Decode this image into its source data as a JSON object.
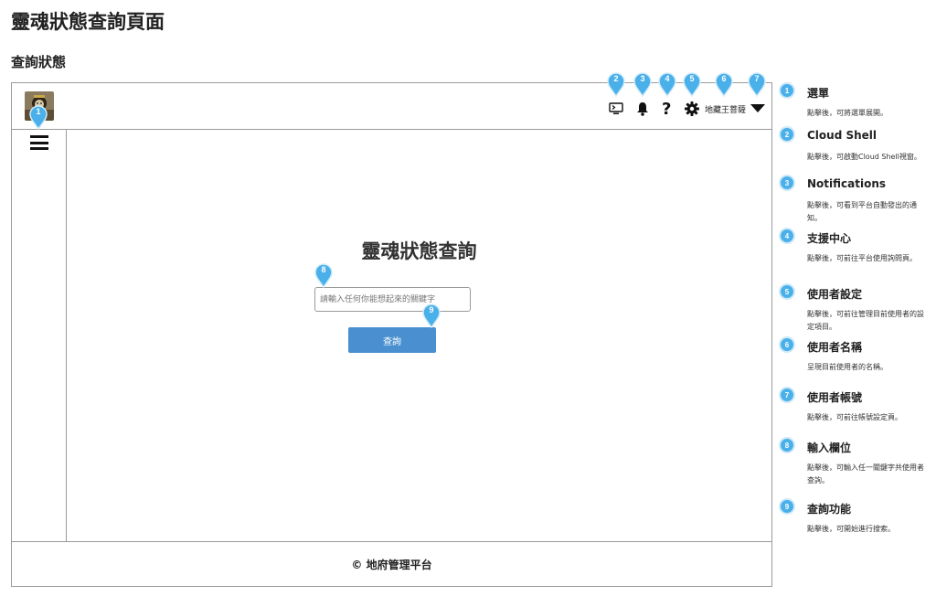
{
  "page": {
    "title": "靈魂狀態查詢頁面",
    "section": "查詢狀態"
  },
  "topbar": {
    "logo": "avatar-logo",
    "icons": [
      "cloud-shell-icon",
      "bell-icon",
      "question-icon",
      "gear-icon",
      "caret-down-icon"
    ],
    "username": "地藏王菩薩"
  },
  "main": {
    "title": "靈魂狀態查詢",
    "search_placeholder": "請輸入任何你能想起來的關鍵字",
    "search_value": "",
    "button_label": "查詢"
  },
  "footer": {
    "text": "© 地府管理平台"
  },
  "markers": {
    "m1": "1",
    "m2": "2",
    "m3": "3",
    "m4": "4",
    "m5": "5",
    "m6": "6",
    "m7": "7",
    "m8": "8",
    "m9": "9"
  },
  "annotations": [
    {
      "num": "1",
      "title": "選單",
      "desc": "點擊後，可將選單展開。"
    },
    {
      "num": "2",
      "title": "Cloud Shell",
      "desc": "點擊後，可啟動Cloud Shell視窗。"
    },
    {
      "num": "3",
      "title": "Notifications",
      "desc": "點擊後，可看到平台自動發出的通知。"
    },
    {
      "num": "4",
      "title": "支援中心",
      "desc": "點擊後，可前往平台使用詢問頁。"
    },
    {
      "num": "5",
      "title": "使用者設定",
      "desc": "點擊後，可前往管理目前使用者的設定項目。"
    },
    {
      "num": "6",
      "title": "使用者名稱",
      "desc": "呈現目前使用者的名稱。"
    },
    {
      "num": "7",
      "title": "使用者帳號",
      "desc": "點擊後，可前往帳號設定頁。"
    },
    {
      "num": "8",
      "title": "輸入欄位",
      "desc": "點擊後，可輸入任一關鍵字共使用者查詢。"
    },
    {
      "num": "9",
      "title": "查詢功能",
      "desc": "點擊後，可開始進行搜索。"
    }
  ],
  "colors": {
    "accent": "#4a90d0",
    "marker": "#4ab0ea",
    "border": "#9a9a9a"
  }
}
